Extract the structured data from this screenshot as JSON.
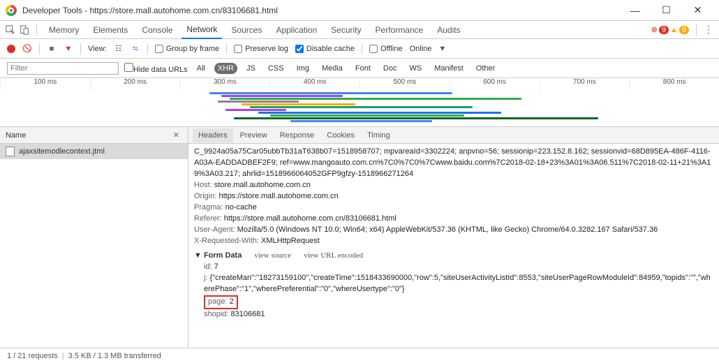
{
  "window": {
    "title": "Developer Tools - https://store.mall.autohome.com.cn/83106681.html",
    "min": "—",
    "max": "☐",
    "close": "✕"
  },
  "mainTabs": [
    "Memory",
    "Elements",
    "Console",
    "Network",
    "Sources",
    "Application",
    "Security",
    "Performance",
    "Audits"
  ],
  "mainTabActive": "Network",
  "badges": {
    "errIcon": "⊗",
    "errCount": "9",
    "warnIcon": "▲",
    "warnCount": "9"
  },
  "toolbar": {
    "view": "View:",
    "group": "Group by frame",
    "preserve": "Preserve log",
    "disable": "Disable cache",
    "offline": "Offline",
    "online": "Online"
  },
  "filter": {
    "placeholder": "Filter",
    "hide": "Hide data URLs",
    "types": [
      "All",
      "XHR",
      "JS",
      "CSS",
      "Img",
      "Media",
      "Font",
      "Doc",
      "WS",
      "Manifest",
      "Other"
    ],
    "active": "XHR"
  },
  "timeline": {
    "ticks": [
      "100 ms",
      "200 ms",
      "300 ms",
      "400 ms",
      "500 ms",
      "600 ms",
      "700 ms",
      "800 ms"
    ]
  },
  "left": {
    "header": "Name",
    "file": "ajaxsitemodlecontext.jtml"
  },
  "subtabs": [
    "Headers",
    "Preview",
    "Response",
    "Cookies",
    "Timing"
  ],
  "subtabActive": "Headers",
  "headersBody": {
    "truncated": "C_9924a05a75Car05ubbTb31aT638b07=1518958707; mpvareaId=3302224; anpvno=56; sessionip=223.152.8.162; sessionvid=68D895EA-486F-4116-A03A-EADDADBEF2F9; ref=www.mangoauto.com.cn%7C0%7C0%7Cwww.baidu.com%7C2018-02-18+23%3A01%3A06.511%7C2018-02-11+21%3A19%3A03.217; ahrlid=1518966064052GFP9gfzy-1518966271264",
    "host_k": "Host:",
    "host_v": " store.mall.autohome.com.cn",
    "origin_k": "Origin:",
    "origin_v": " https://store.mall.autohome.com.cn",
    "pragma_k": "Pragma:",
    "pragma_v": " no-cache",
    "referer_k": "Referer:",
    "referer_v": " https://store.mall.autohome.com.cn/83106681.html",
    "ua_k": "User-Agent:",
    "ua_v": " Mozilla/5.0 (Windows NT 10.0; Win64; x64) AppleWebKit/537.36 (KHTML, like Gecko) Chrome/64.0.3282.167 Safari/537.36",
    "xrw_k": "X-Requested-With:",
    "xrw_v": " XMLHttpRequest",
    "form": "▼ Form Data",
    "vs": "view source",
    "vu": "view URL encoded",
    "id_k": "id:",
    "id_v": " 7",
    "j_k": "j:",
    "j_v": " {\"createMan\":\"18273159100\",\"createTime\":1518433690000,\"row\":5,\"siteUserActivityListId\":8553,\"siteUserPageRowModuleId\":84959,\"topids\":\"\",\"wherePhase\":\"1\",\"wherePreferential\":\"0\",\"whereUsertype\":\"0\"}",
    "page_k": "page:",
    "page_v": " 2",
    "shopid_k": "shopid:",
    "shopid_v": " 83106681"
  },
  "status": {
    "req": "1 / 21 requests",
    "xfer": "3.5 KB / 1.3 MB transferred"
  }
}
